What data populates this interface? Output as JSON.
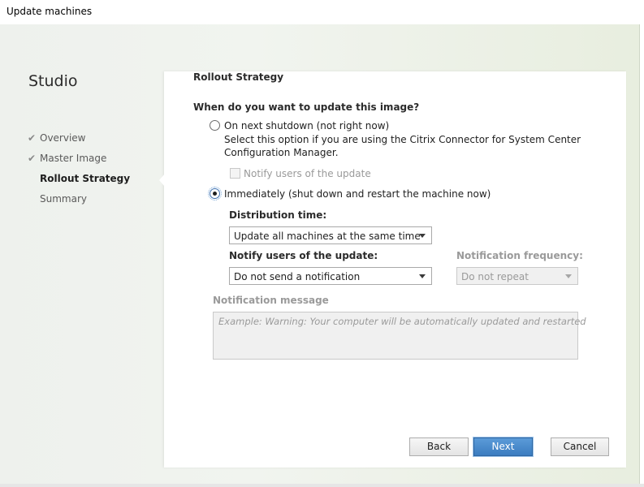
{
  "window": {
    "title": "Update machines"
  },
  "sidebar": {
    "heading": "Studio",
    "items": [
      {
        "label": "Overview",
        "state": "done"
      },
      {
        "label": "Master Image",
        "state": "done"
      },
      {
        "label": "Rollout Strategy",
        "state": "active"
      },
      {
        "label": "Summary",
        "state": "pending"
      }
    ]
  },
  "page": {
    "title": "Rollout Strategy",
    "question": "When do you want to update this image?",
    "option_shutdown": {
      "label": "On next shutdown (not right now)",
      "desc_line1": "Select this option if you are using the Citrix Connector for System Center",
      "desc_line2": "Configuration Manager.",
      "notify_label": "Notify users of the update",
      "selected": false
    },
    "option_immediate": {
      "label": "Immediately (shut down and restart the machine now)",
      "selected": true
    },
    "distribution_time": {
      "label": "Distribution time:",
      "value": "Update all machines at the same time"
    },
    "notify_users": {
      "label": "Notify users of the update:",
      "value": "Do not send a notification"
    },
    "notification_frequency": {
      "label": "Notification frequency:",
      "value": "Do not repeat"
    },
    "notification_message": {
      "label": "Notification message",
      "placeholder": "Example:  Warning: Your computer will be automatically updated and restarted"
    }
  },
  "buttons": {
    "back": "Back",
    "next": "Next",
    "cancel": "Cancel"
  }
}
